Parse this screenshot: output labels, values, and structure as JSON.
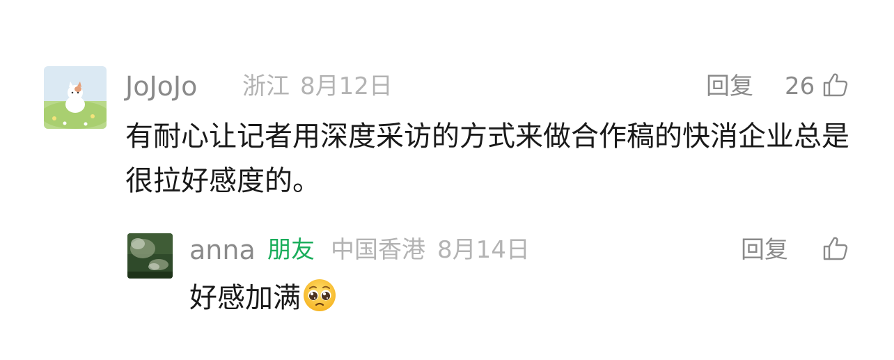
{
  "comments": [
    {
      "author": "JoJoJo",
      "location": "浙江",
      "date": "8月12日",
      "reply_label": "回复",
      "like_count": "26",
      "text": "有耐心让记者用深度采访的方式来做合作稿的快消企业总是很拉好感度的。"
    }
  ],
  "replies": [
    {
      "author": "anna",
      "badge": "朋友",
      "location": "中国香港",
      "date": "8月14日",
      "reply_label": "回复",
      "text": "好感加满",
      "emoji_icon": "pleading-face-icon"
    }
  ],
  "colors": {
    "name": "#8a8a8a",
    "meta": "#b3b3b3",
    "friend_badge": "#1aad5b",
    "body_text": "#191919"
  }
}
